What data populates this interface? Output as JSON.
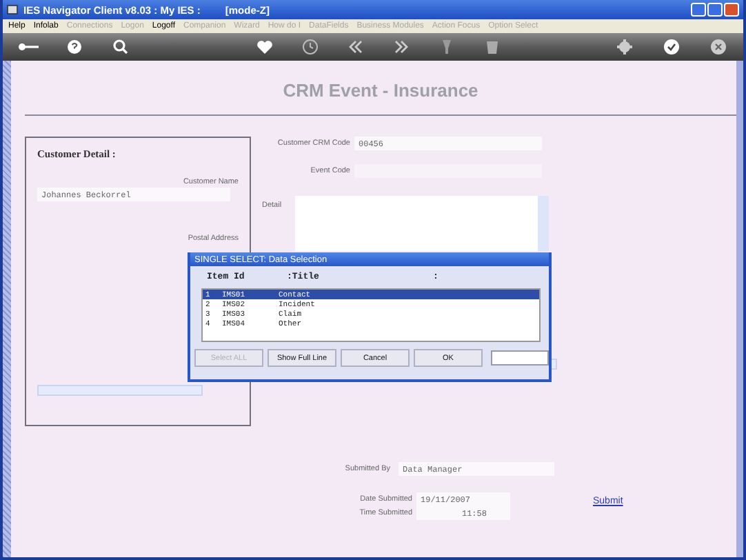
{
  "window": {
    "title": "IES Navigator Client v8.03 : My IES :",
    "mode": "[mode-Z]"
  },
  "menu": [
    {
      "label": "Help",
      "disabled": false
    },
    {
      "label": "Infolab",
      "disabled": false
    },
    {
      "label": "Connections",
      "disabled": true
    },
    {
      "label": "Logon",
      "disabled": true
    },
    {
      "label": "Logoff",
      "disabled": false
    },
    {
      "label": "Companion",
      "disabled": true
    },
    {
      "label": "Wizard",
      "disabled": true
    },
    {
      "label": "How do I",
      "disabled": true
    },
    {
      "label": "DataFields",
      "disabled": true
    },
    {
      "label": "Business Modules",
      "disabled": true
    },
    {
      "label": "Action Focus",
      "disabled": true
    },
    {
      "label": "Option Select",
      "disabled": true
    }
  ],
  "page": {
    "title": "CRM Event  - Insurance"
  },
  "customer_detail": {
    "heading": "Customer Detail :",
    "name_label": "Customer Name",
    "name_value": "Johannes Beckorrel",
    "address_label": "Postal Address"
  },
  "event": {
    "crm_code_label": "Customer CRM Code",
    "crm_code_value": "00456",
    "event_code_label": "Event Code",
    "detail_label": "Detail"
  },
  "submission": {
    "by_label": "Submitted By",
    "by_value": "Data Manager",
    "date_label": "Date Submitted",
    "date_value": "19/11/2007",
    "time_label": "Time Submitted",
    "time_value": "11:58",
    "submit_link": "Submit"
  },
  "dialog": {
    "title": "SINGLE SELECT: Data Selection",
    "columns": [
      "Item Id",
      ":Title",
      ":"
    ],
    "rows": [
      {
        "index": "1",
        "id": "IMS01",
        "title": "Contact",
        "selected": true
      },
      {
        "index": "2",
        "id": "IMS02",
        "title": "Incident",
        "selected": false
      },
      {
        "index": "3",
        "id": "IMS03",
        "title": "Claim",
        "selected": false
      },
      {
        "index": "4",
        "id": "IMS04",
        "title": "Other",
        "selected": false
      }
    ],
    "buttons": [
      {
        "label": "Select ALL",
        "disabled": true
      },
      {
        "label": "Show Full Line",
        "disabled": false
      },
      {
        "label": "Cancel",
        "disabled": false
      },
      {
        "label": "OK",
        "disabled": false
      }
    ]
  }
}
